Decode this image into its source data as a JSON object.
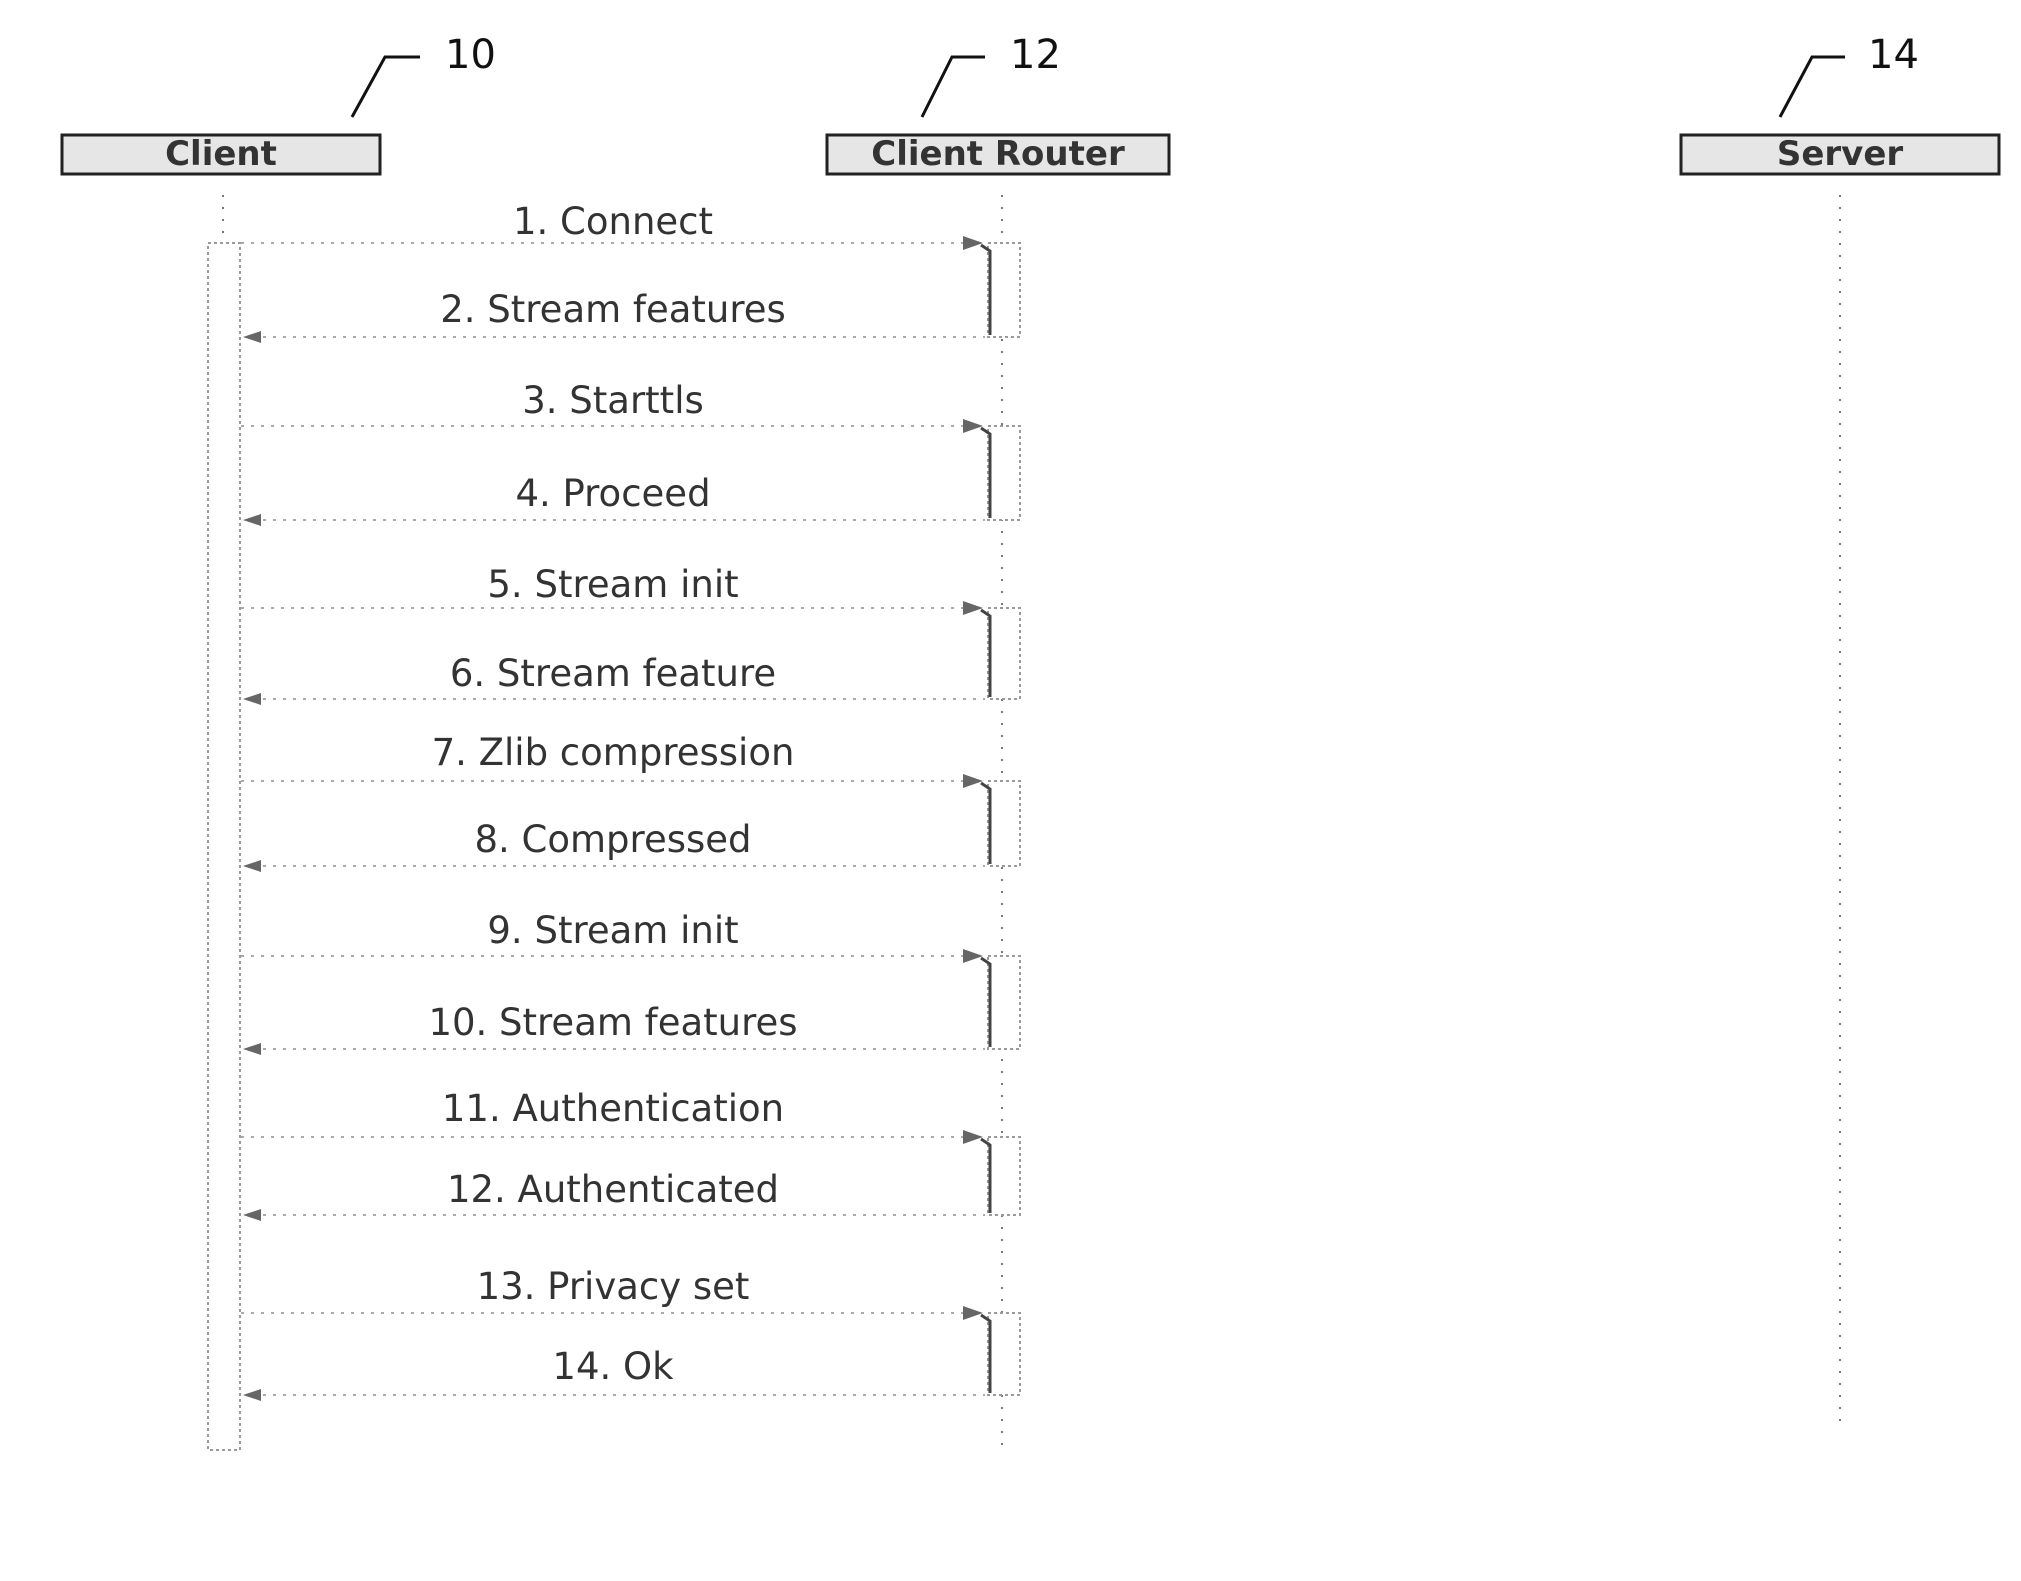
{
  "diagram": {
    "type": "sequence",
    "actors": [
      {
        "id": "client",
        "label": "Client",
        "ref": "10"
      },
      {
        "id": "router",
        "label": "Client Router",
        "ref": "12"
      },
      {
        "id": "server",
        "label": "Server",
        "ref": "14"
      }
    ],
    "messages": [
      {
        "label": "1.  Connect",
        "from": "client",
        "to": "router"
      },
      {
        "label": "2.  Stream features",
        "from": "router",
        "to": "client"
      },
      {
        "label": "3.  Starttls",
        "from": "client",
        "to": "router"
      },
      {
        "label": "4.  Proceed",
        "from": "router",
        "to": "client"
      },
      {
        "label": "5.  Stream init",
        "from": "client",
        "to": "router"
      },
      {
        "label": "6.  Stream feature",
        "from": "router",
        "to": "client"
      },
      {
        "label": "7.  Zlib compression",
        "from": "client",
        "to": "router"
      },
      {
        "label": "8.  Compressed",
        "from": "router",
        "to": "client"
      },
      {
        "label": "9.  Stream init",
        "from": "client",
        "to": "router"
      },
      {
        "label": "10.  Stream features",
        "from": "router",
        "to": "client"
      },
      {
        "label": "11.  Authentication",
        "from": "client",
        "to": "router"
      },
      {
        "label": "12.  Authenticated",
        "from": "router",
        "to": "client"
      },
      {
        "label": "13.  Privacy set",
        "from": "client",
        "to": "router"
      },
      {
        "label": "14.  Ok",
        "from": "router",
        "to": "client"
      }
    ]
  }
}
